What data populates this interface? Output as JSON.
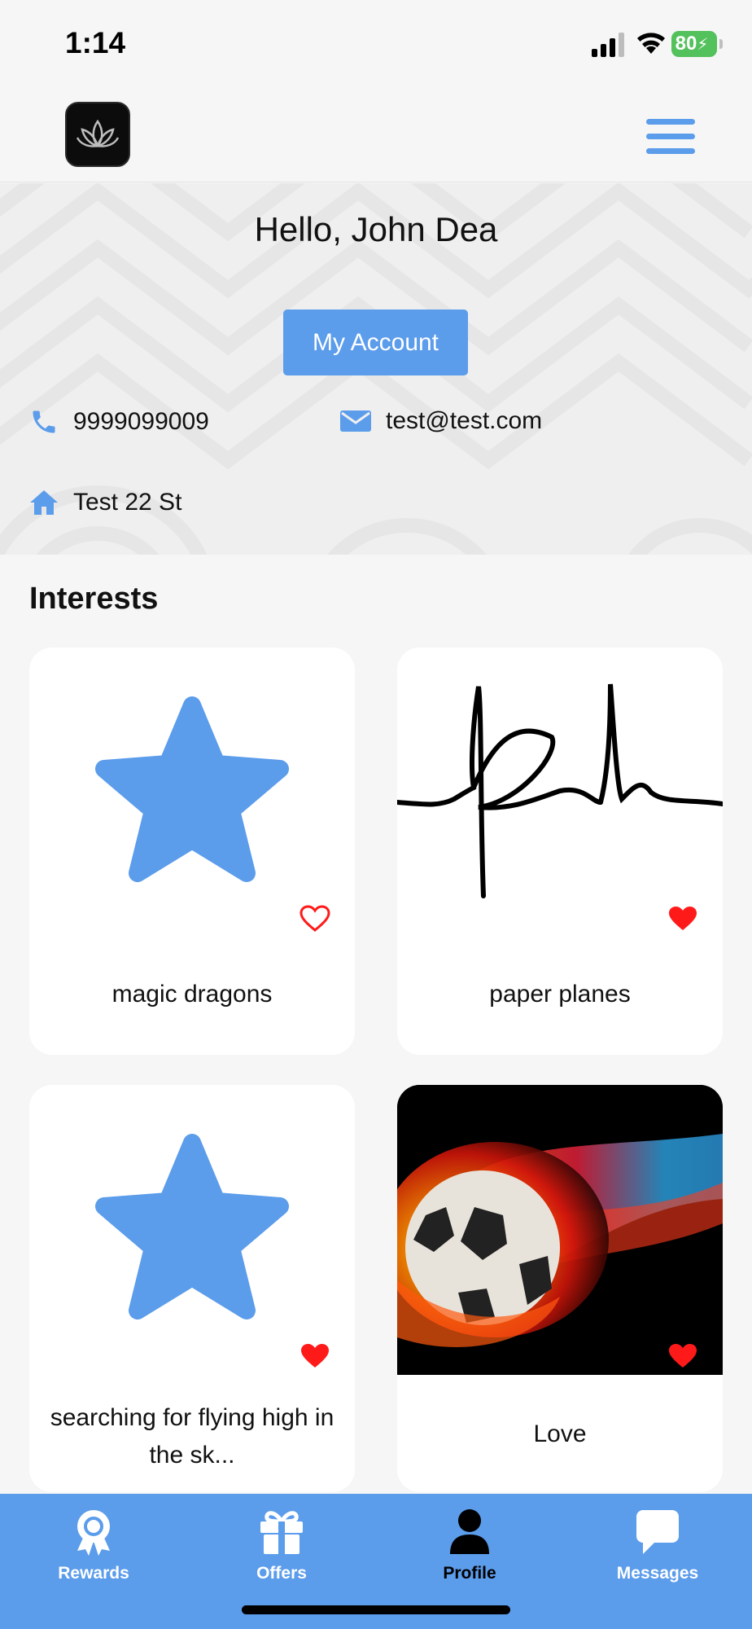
{
  "status_bar": {
    "time": "1:14",
    "battery": "80"
  },
  "header": {
    "logo_icon": "lotus-logo-icon",
    "menu_icon": "hamburger-menu-icon"
  },
  "profile": {
    "greeting": "Hello, John Dea",
    "account_button": "My Account",
    "phone": "9999099009",
    "email": "test@test.com",
    "address": "Test 22 St"
  },
  "interests": {
    "title": "Interests",
    "items": [
      {
        "label": "magic dragons",
        "image": "star-icon",
        "favorited": false
      },
      {
        "label": "paper planes",
        "image": "signature-image",
        "favorited": true
      },
      {
        "label": "searching for flying high in the sk...",
        "image": "star-icon",
        "favorited": true
      },
      {
        "label": "Love",
        "image": "flaming-soccer-ball-image",
        "favorited": true
      }
    ]
  },
  "nav": {
    "items": [
      {
        "label": "Rewards",
        "icon": "award-icon",
        "active": false
      },
      {
        "label": "Offers",
        "icon": "gift-icon",
        "active": false
      },
      {
        "label": "Profile",
        "icon": "user-icon",
        "active": true
      },
      {
        "label": "Messages",
        "icon": "chat-icon",
        "active": false
      }
    ]
  },
  "colors": {
    "accent": "#5b9ceb",
    "heart": "#ff1a1a",
    "background": "#f6f6f6",
    "card": "#ffffff"
  }
}
